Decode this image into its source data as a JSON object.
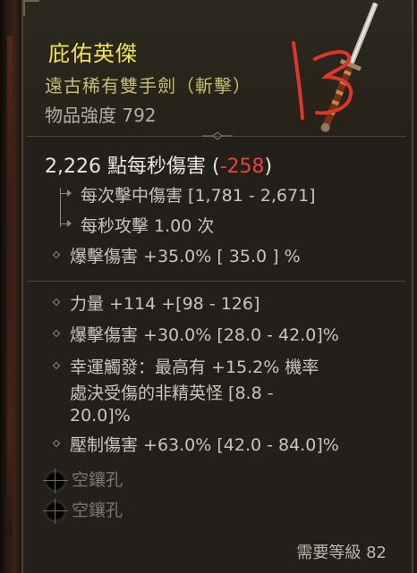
{
  "item": {
    "name": "庇佑英傑",
    "type": "遠古稀有雙手劍（斬擊）",
    "power": "物品強度 792"
  },
  "damage": {
    "dps_main": "2,226 點每秒傷害 (",
    "dps_delta": "-258",
    "dps_close": ")",
    "per_hit": "每次擊中傷害 [1,781 - 2,671]",
    "attack_speed": "每秒攻擊 1.00 次",
    "crit": "爆擊傷害 +35.0%  [ 35.0 ] %"
  },
  "affixes": [
    "力量 +114 +[98 - 126]",
    "爆擊傷害 +30.0% [28.0 - 42.0]%",
    "幸運觸發：最高有 +15.2% 機率",
    "處決受傷的非精英怪 [8.8 -",
    "20.0]%",
    "壓制傷害 +63.0% [42.0 - 84.0]%"
  ],
  "sockets": [
    "空鑲孔",
    "空鑲孔"
  ],
  "requirement": "需要等級 82",
  "colors": {
    "title": "#f2e45a",
    "subtitle": "#c8bb73",
    "negative": "#e8433a",
    "annotation": "#e0362a"
  },
  "icons": [
    "sword-icon",
    "diamond-bullet-icon",
    "socket-icon"
  ]
}
